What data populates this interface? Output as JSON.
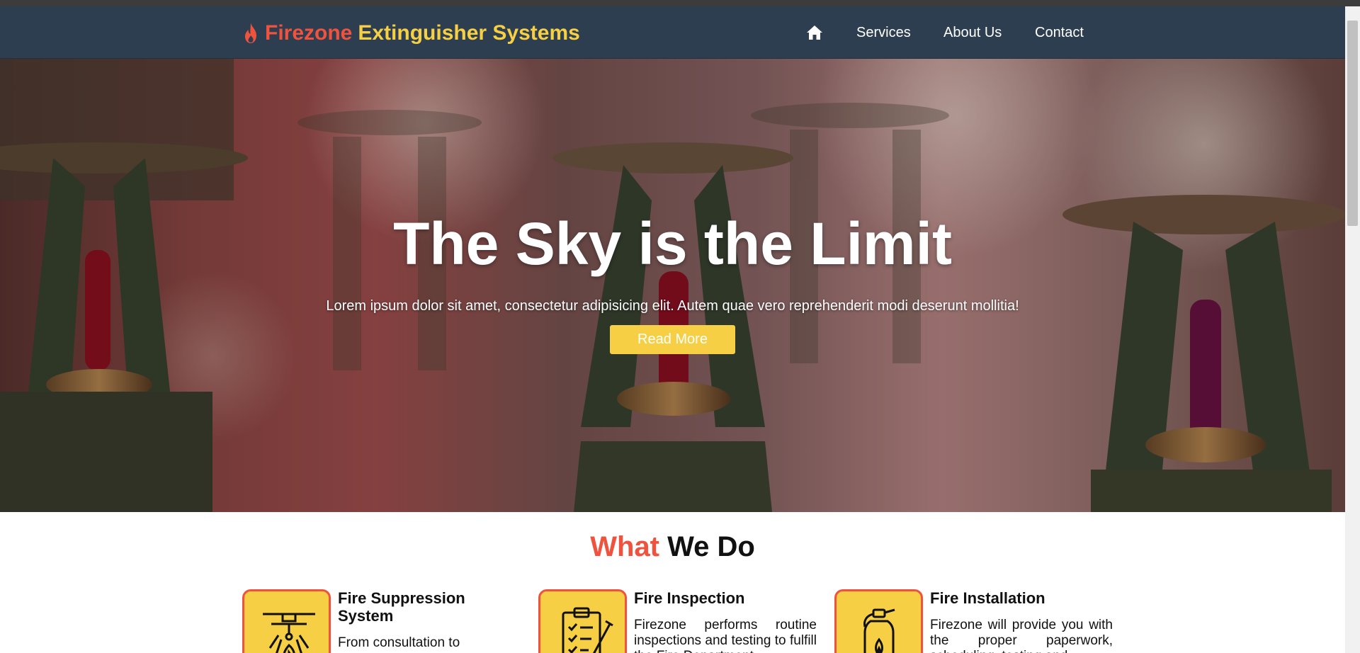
{
  "brand": {
    "word1": "Firezone",
    "word2": "Extinguisher Systems",
    "icon": "flame-icon",
    "colors": {
      "red": "#f0533d",
      "yellow": "#f6cf45"
    }
  },
  "nav": {
    "home_icon": "home-icon",
    "items": [
      {
        "label": "Services"
      },
      {
        "label": "About Us"
      },
      {
        "label": "Contact"
      }
    ],
    "background": "#2c3e50"
  },
  "hero": {
    "title": "The Sky is the Limit",
    "subtitle": "Lorem ipsum dolor sit amet, consectetur adipisicing elit. Autem quae vero reprehenderit modi deserunt mollitia!",
    "button_label": "Read More",
    "image": "fire-sprinkler-heads-photo"
  },
  "section": {
    "title_part1": "What",
    "title_part2": "We Do"
  },
  "services": [
    {
      "title": "Fire Suppression System",
      "text": "From consultation to",
      "icon": "sprinkler-icon"
    },
    {
      "title": "Fire Inspection",
      "text": "Firezone performs routine inspections and testing to fulfill the Fire Department",
      "icon": "clipboard-checklist-icon"
    },
    {
      "title": "Fire Installation",
      "text": "Firezone will provide you with the proper paperwork, scheduling, testing and",
      "icon": "fire-extinguisher-icon"
    }
  ]
}
